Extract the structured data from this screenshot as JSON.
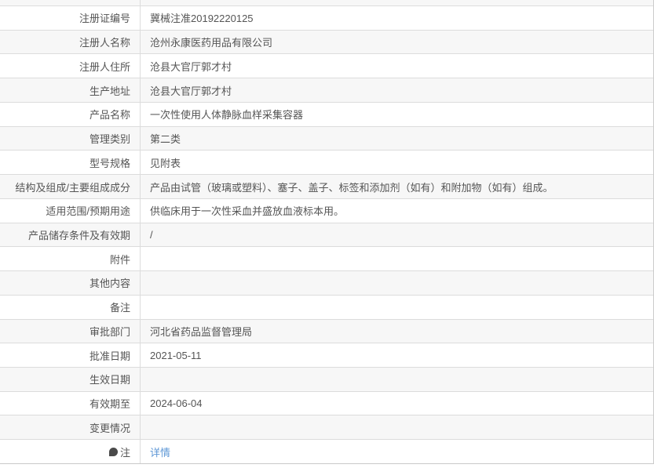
{
  "table": {
    "rows": [
      {
        "label": "注册证编号",
        "value": "冀械注准20192220125"
      },
      {
        "label": "注册人名称",
        "value": "沧州永康医药用品有限公司"
      },
      {
        "label": "注册人住所",
        "value": "沧县大官厅郭才村"
      },
      {
        "label": "生产地址",
        "value": "沧县大官厅郭才村"
      },
      {
        "label": "产品名称",
        "value": "一次性使用人体静脉血样采集容器"
      },
      {
        "label": "管理类别",
        "value": "第二类"
      },
      {
        "label": "型号规格",
        "value": "见附表"
      },
      {
        "label": "结构及组成/主要组成成分",
        "value": "产品由试管（玻璃或塑料）、塞子、盖子、标签和添加剂（如有）和附加物（如有）组成。"
      },
      {
        "label": "适用范围/预期用途",
        "value": "供临床用于一次性采血并盛放血液标本用。"
      },
      {
        "label": "产品储存条件及有效期",
        "value": "/"
      },
      {
        "label": "附件",
        "value": ""
      },
      {
        "label": "其他内容",
        "value": ""
      },
      {
        "label": "备注",
        "value": ""
      },
      {
        "label": "审批部门",
        "value": "河北省药品监督管理局"
      },
      {
        "label": "批准日期",
        "value": "2021-05-11"
      },
      {
        "label": "生效日期",
        "value": ""
      },
      {
        "label": "有效期至",
        "value": "2024-06-04"
      },
      {
        "label": "变更情况",
        "value": ""
      },
      {
        "label": "注",
        "value": "详情",
        "link": true,
        "icon": "note-balloon-icon"
      }
    ]
  },
  "colors": {
    "link": "#5e97d6",
    "text": "#555555",
    "row_alt_bg": "#f7f7f7",
    "row_border": "#dcdcdc",
    "outer_border": "#cccccc",
    "note_icon": "#4a4a4a"
  }
}
